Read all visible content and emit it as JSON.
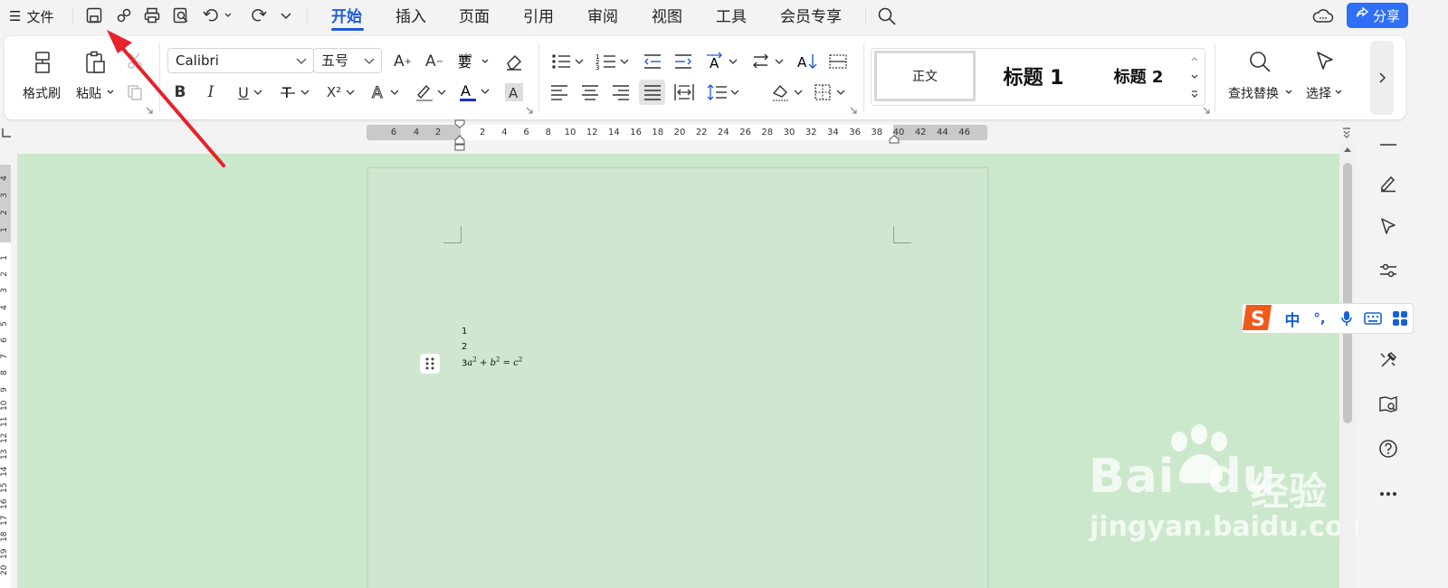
{
  "menu": {
    "file_label": "文件",
    "menu_glyph": "☰"
  },
  "tabs": [
    {
      "label": "开始",
      "active": true
    },
    {
      "label": "插入"
    },
    {
      "label": "页面"
    },
    {
      "label": "引用"
    },
    {
      "label": "审阅"
    },
    {
      "label": "视图"
    },
    {
      "label": "工具"
    },
    {
      "label": "会员专享"
    }
  ],
  "share": {
    "label": "分享",
    "color": "#2f6ff5"
  },
  "ribbon": {
    "format_painter": "格式刷",
    "paste": "粘贴",
    "font_name": "Calibri",
    "font_size": "五号",
    "bold": "B",
    "italic": "I",
    "underline": "U",
    "superscript": "X²",
    "styles": {
      "normal": "正文",
      "h1": "标题 1",
      "h2": "标题 2"
    },
    "find_replace": "查找替换",
    "select": "选择"
  },
  "ruler": {
    "numbers_left": [
      "6",
      "4",
      "2"
    ],
    "numbers_right": [
      "2",
      "4",
      "6",
      "8",
      "10",
      "12",
      "14",
      "16",
      "18",
      "20",
      "22",
      "24",
      "26",
      "28",
      "30",
      "32",
      "34",
      "36",
      "38",
      "40",
      "42",
      "44",
      "46"
    ],
    "vertical_top": [
      "4",
      "3",
      "2",
      "1"
    ],
    "vertical": [
      "1",
      "2",
      "3",
      "4",
      "5",
      "6",
      "7",
      "8",
      "9",
      "10",
      "11",
      "12",
      "13",
      "14",
      "15",
      "16",
      "17",
      "18",
      "19",
      "20"
    ]
  },
  "document": {
    "line1": "1",
    "line2": "2",
    "line3_prefix": "3",
    "equation": {
      "a": "a",
      "plus": "+",
      "b": "b",
      "eq": "=",
      "c": "c",
      "exp": "2"
    }
  },
  "ime": {
    "lang": "中",
    "punct": "°,"
  },
  "watermark": {
    "brand": "Bai",
    "brand2": "du",
    "jingyan": "经验",
    "url": "jingyan.baidu.com"
  },
  "colors": {
    "accent": "#1f5bd6",
    "page_bg": "#cfe7cf",
    "canvas_bg": "#cce8cc",
    "arrow": "#e8212a"
  }
}
